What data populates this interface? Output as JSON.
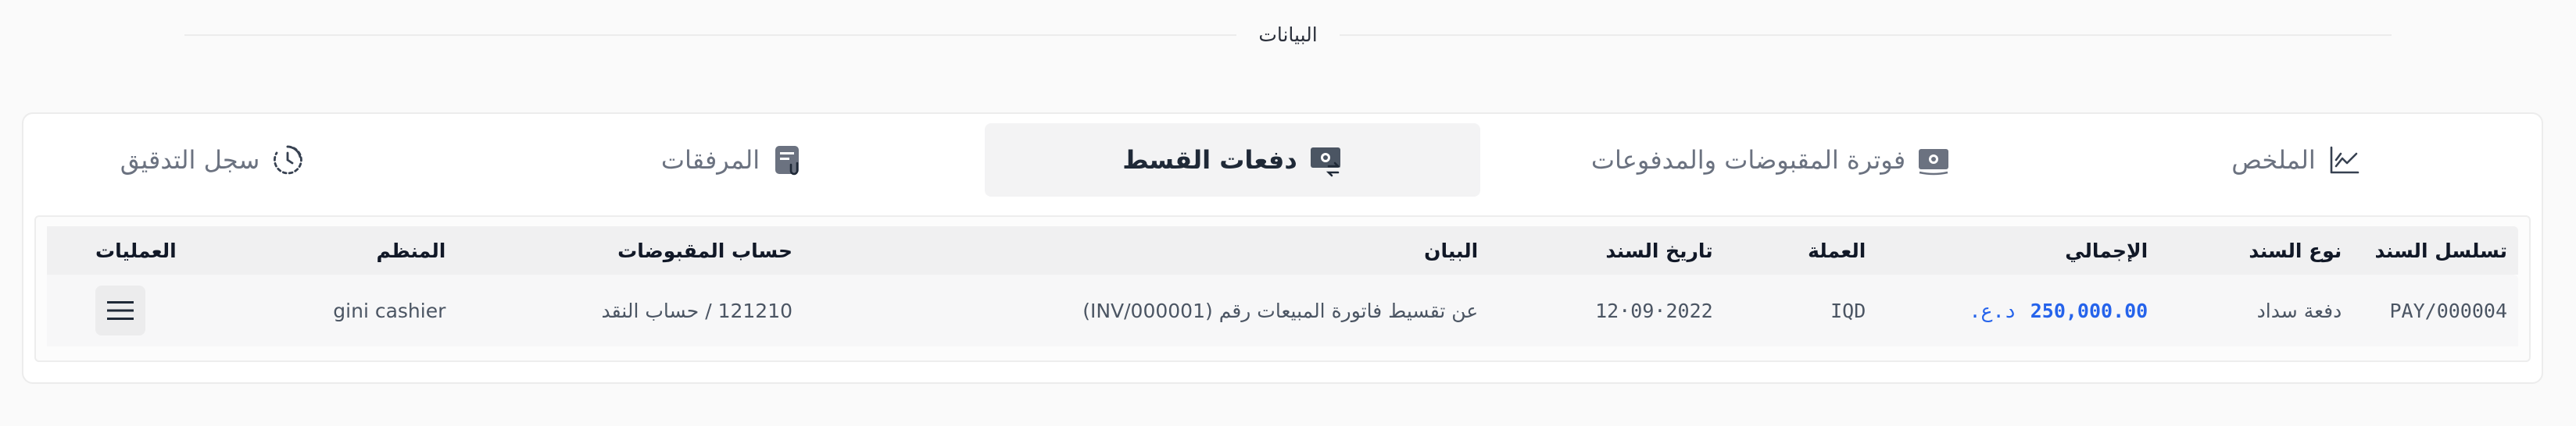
{
  "section": {
    "title": "البيانات"
  },
  "tabs": [
    {
      "label": "الملخص",
      "icon": "chart-line-icon",
      "active": false
    },
    {
      "label": "فوترة المقبوضات والمدفوعات",
      "icon": "money-bill-icon",
      "active": false
    },
    {
      "label": "دفعات القسط",
      "icon": "money-exchange-icon",
      "active": true
    },
    {
      "label": "المرفقات",
      "icon": "file-attachment-icon",
      "active": false
    },
    {
      "label": "سجل التدقيق",
      "icon": "history-clock-icon",
      "active": false
    }
  ],
  "table": {
    "headers": {
      "serial": "تسلسل السند",
      "type": "نوع السند",
      "total": "الإجمالي",
      "currency": "العملة",
      "date": "تاريخ السند",
      "statement": "البيان",
      "account": "حساب المقبوضات",
      "organizer": "المنظم",
      "operations": "العمليات"
    },
    "rows": [
      {
        "serial": "PAY/000004",
        "type": "دفعة سداد",
        "total": "250,000.00",
        "total_currency": "د.ع.",
        "currency": "IQD",
        "date": "2022·09·12",
        "statement": "عن تقسيط فاتورة المبيعات رقم (INV/000001)",
        "account": "121210 / حساب النقد",
        "organizer": "gini cashier"
      }
    ]
  },
  "colors": {
    "accent": "#2563eb",
    "active_tab_bg": "#f3f3f4",
    "header_row_bg": "#f0f0f1"
  }
}
